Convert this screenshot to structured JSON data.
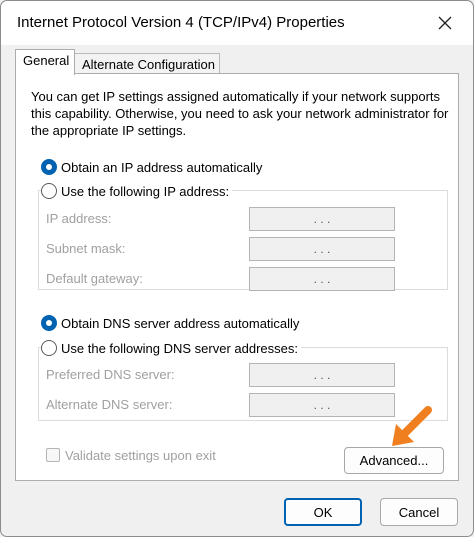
{
  "window": {
    "title": "Internet Protocol Version 4 (TCP/IPv4) Properties"
  },
  "tabs": [
    {
      "label": "General",
      "active": true
    },
    {
      "label": "Alternate Configuration",
      "active": false
    }
  ],
  "description": "You can get IP settings assigned automatically if your network supports this capability. Otherwise, you need to ask your network administrator for the appropriate IP settings.",
  "ip": {
    "auto_label": "Obtain an IP address automatically",
    "manual_label": "Use the following IP address:",
    "selected": "auto",
    "fields": [
      {
        "label": "IP address:",
        "value": ". . ."
      },
      {
        "label": "Subnet mask:",
        "value": ". . ."
      },
      {
        "label": "Default gateway:",
        "value": ". . ."
      }
    ]
  },
  "dns": {
    "auto_label": "Obtain DNS server address automatically",
    "manual_label": "Use the following DNS server addresses:",
    "selected": "auto",
    "fields": [
      {
        "label": "Preferred DNS server:",
        "value": ". . ."
      },
      {
        "label": "Alternate DNS server:",
        "value": ". . ."
      }
    ]
  },
  "validate_label": "Validate settings upon exit",
  "buttons": {
    "advanced": "Advanced...",
    "ok": "OK",
    "cancel": "Cancel"
  },
  "colors": {
    "accent": "#0063b1",
    "arrow": "#f07f1f"
  }
}
